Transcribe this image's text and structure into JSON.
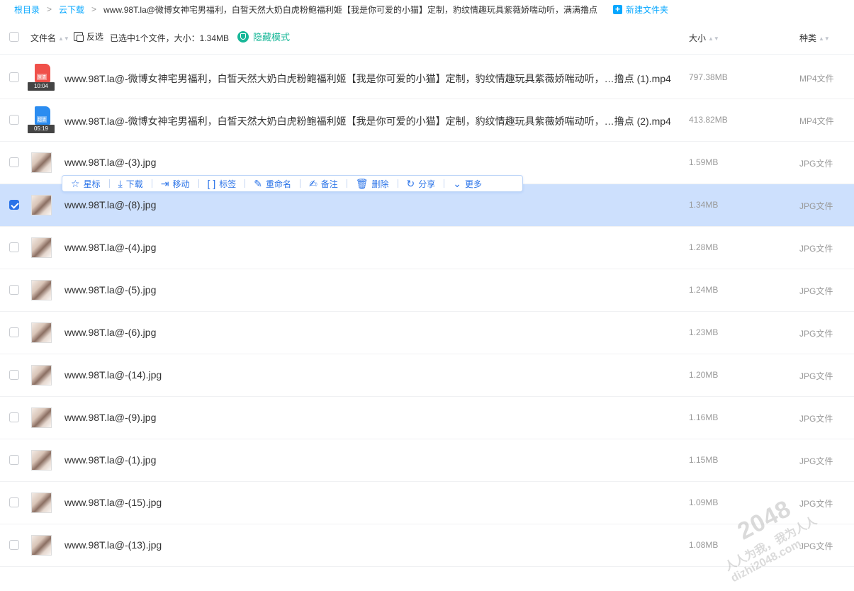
{
  "breadcrumb": {
    "root": "根目录",
    "folder": "云下载",
    "current": "www.98T.la@微博女神宅男福利，白皙天然大奶白虎粉鲍福利姬【我是你可爱的小猫】定制，豹纹情趣玩具紫薇娇喘动听，满满撸点",
    "new_folder": "新建文件夹"
  },
  "header": {
    "name_col": "文件名",
    "invert_select": "反选",
    "selection_info": "已选中1个文件，大小：1.34MB",
    "hidden_mode": "隐藏模式",
    "size_col": "大小",
    "type_col": "种类"
  },
  "toolbar": {
    "items": [
      {
        "label": "星标",
        "icon": "star-icon"
      },
      {
        "label": "下载",
        "icon": "download-icon"
      },
      {
        "label": "移动",
        "icon": "move-icon"
      },
      {
        "label": "标签",
        "icon": "tag-icon"
      },
      {
        "label": "重命名",
        "icon": "rename-icon"
      },
      {
        "label": "备注",
        "icon": "note-icon"
      },
      {
        "label": "删除",
        "icon": "trash-icon"
      },
      {
        "label": "分享",
        "icon": "share-icon"
      },
      {
        "label": "更多",
        "icon": "chevron-down-icon"
      }
    ]
  },
  "files": [
    {
      "name": "www.98T.la@-微博女神宅男福利，白皙天然大奶白虎粉鲍福利姬【我是你可爱的小猫】定制，豹纹情趣玩具紫薇娇喘动听，…撸点 (1).mp4",
      "size": "797.38MB",
      "type": "MP4文件",
      "kind": "video",
      "badge": "原清",
      "duration": "10:04",
      "color": "#f0504a",
      "selected": false
    },
    {
      "name": "www.98T.la@-微博女神宅男福利，白皙天然大奶白虎粉鲍福利姬【我是你可爱的小猫】定制，豹纹情趣玩具紫薇娇喘动听，…撸点 (2).mp4",
      "size": "413.82MB",
      "type": "MP4文件",
      "kind": "video",
      "badge": "超清",
      "duration": "05:19",
      "color": "#2b8cf0",
      "selected": false
    },
    {
      "name": "www.98T.la@-(3).jpg",
      "size": "1.59MB",
      "type": "JPG文件",
      "kind": "image",
      "selected": false
    },
    {
      "name": "www.98T.la@-(8).jpg",
      "size": "1.34MB",
      "type": "JPG文件",
      "kind": "image",
      "selected": true
    },
    {
      "name": "www.98T.la@-(4).jpg",
      "size": "1.28MB",
      "type": "JPG文件",
      "kind": "image",
      "selected": false
    },
    {
      "name": "www.98T.la@-(5).jpg",
      "size": "1.24MB",
      "type": "JPG文件",
      "kind": "image",
      "selected": false
    },
    {
      "name": "www.98T.la@-(6).jpg",
      "size": "1.23MB",
      "type": "JPG文件",
      "kind": "image",
      "selected": false
    },
    {
      "name": "www.98T.la@-(14).jpg",
      "size": "1.20MB",
      "type": "JPG文件",
      "kind": "image",
      "selected": false
    },
    {
      "name": "www.98T.la@-(9).jpg",
      "size": "1.16MB",
      "type": "JPG文件",
      "kind": "image",
      "selected": false
    },
    {
      "name": "www.98T.la@-(1).jpg",
      "size": "1.15MB",
      "type": "JPG文件",
      "kind": "image",
      "selected": false
    },
    {
      "name": "www.98T.la@-(15).jpg",
      "size": "1.09MB",
      "type": "JPG文件",
      "kind": "image",
      "selected": false
    },
    {
      "name": "www.98T.la@-(13).jpg",
      "size": "1.08MB",
      "type": "JPG文件",
      "kind": "image",
      "selected": false
    }
  ],
  "watermark": {
    "big": "2048",
    "line1": "人人为我，我为人人",
    "line2": "dizhi2048.com"
  },
  "colors": {
    "accent": "#06a7ff",
    "selected_row": "#cde0fd",
    "checkbox_checked": "#2a73e8",
    "hidden_mode": "#18b798"
  }
}
